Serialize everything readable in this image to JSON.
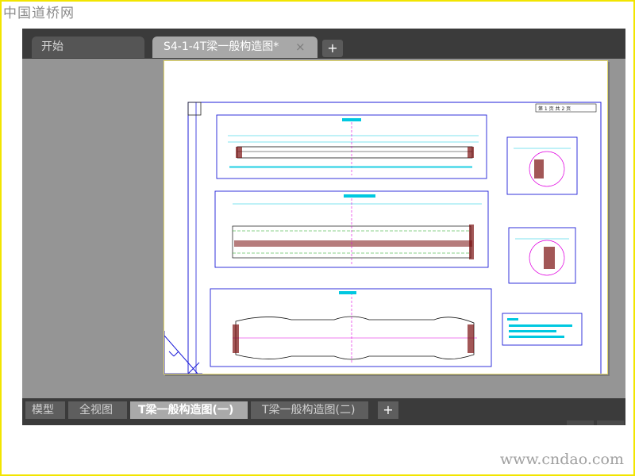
{
  "watermarks": {
    "top": "中国道桥网",
    "bottom": "www.cndao.com"
  },
  "doc_tabs": [
    {
      "label": "开始"
    },
    {
      "label": "S4-1-4T梁一般构造图*"
    }
  ],
  "icons": {
    "close": "×",
    "add": "+"
  },
  "layout_tabs": [
    {
      "label": "模型"
    },
    {
      "label": "全视图"
    },
    {
      "label": "T梁一般构造图(一)"
    },
    {
      "label": "T梁一般构造图(二)"
    }
  ],
  "drawing": {
    "sheet_label": "第 1 页  共 2 页",
    "title_block": [
      "设计",
      "复核",
      "审核",
      "图号"
    ],
    "colors": {
      "line": "#1d1dd8",
      "dim": "#00c8e0",
      "axis": "#e000e0",
      "hatch": "#7a1010",
      "note": "#10a010"
    }
  }
}
